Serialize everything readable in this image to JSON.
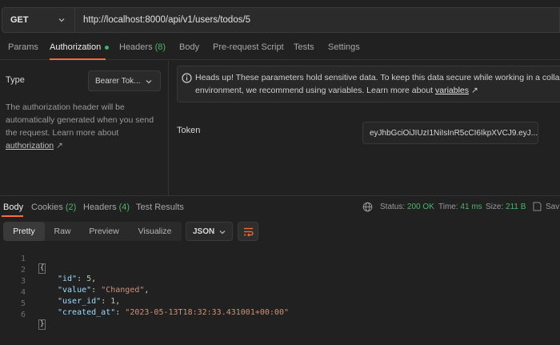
{
  "request": {
    "method": "GET",
    "url": "http://localhost:8000/api/v1/users/todos/5"
  },
  "request_tabs": [
    {
      "label": "Params"
    },
    {
      "label": "Authorization",
      "active": true
    },
    {
      "label": "Headers",
      "count": "(8)"
    },
    {
      "label": "Body"
    },
    {
      "label": "Pre-request Script"
    },
    {
      "label": "Tests"
    },
    {
      "label": "Settings"
    }
  ],
  "auth": {
    "type_label": "Type",
    "type_value": "Bearer Tok...",
    "description": "The authorization header will be automatically generated when you send the request. Learn more about",
    "link_text": "authorization",
    "link_arrow": "↗"
  },
  "notice": {
    "line1": "Heads up! These parameters hold sensitive data. To keep this data secure while working in a collabora",
    "line2_prefix": "environment, we recommend using variables. Learn more about ",
    "link_text": "variables",
    "link_arrow": "↗"
  },
  "token": {
    "label": "Token",
    "value": "eyJhbGciOiJIUzI1NiIsInR5cCI6IkpXVCJ9.eyJ..."
  },
  "response_tabs": [
    {
      "label": "Body",
      "active": true
    },
    {
      "label": "Cookies",
      "count": "(2)"
    },
    {
      "label": "Headers",
      "count": "(4)"
    },
    {
      "label": "Test Results"
    }
  ],
  "status": {
    "status_label": "Status:",
    "status_value": "200 OK",
    "time_label": "Time:",
    "time_value": "41 ms",
    "size_label": "Size:",
    "size_value": "211 B",
    "save_label": "Sav"
  },
  "view_modes": [
    {
      "label": "Pretty",
      "active": true
    },
    {
      "label": "Raw"
    },
    {
      "label": "Preview"
    },
    {
      "label": "Visualize"
    }
  ],
  "format": "JSON",
  "code_lines": [
    {
      "n": "1"
    },
    {
      "n": "2",
      "key": "\"id\"",
      "val": "5",
      "type": "num",
      "comma": ","
    },
    {
      "n": "3",
      "key": "\"value\"",
      "val": "\"Changed\"",
      "type": "str",
      "comma": ","
    },
    {
      "n": "4",
      "key": "\"user_id\"",
      "val": "1",
      "type": "num",
      "comma": ","
    },
    {
      "n": "5",
      "key": "\"created_at\"",
      "val": "\"2023-05-13T18:32:33.431001+00:00\"",
      "type": "str",
      "comma": ""
    },
    {
      "n": "6"
    }
  ],
  "colors": {
    "accent": "#ff6c37",
    "success": "#4db36a",
    "background": "#212121"
  }
}
